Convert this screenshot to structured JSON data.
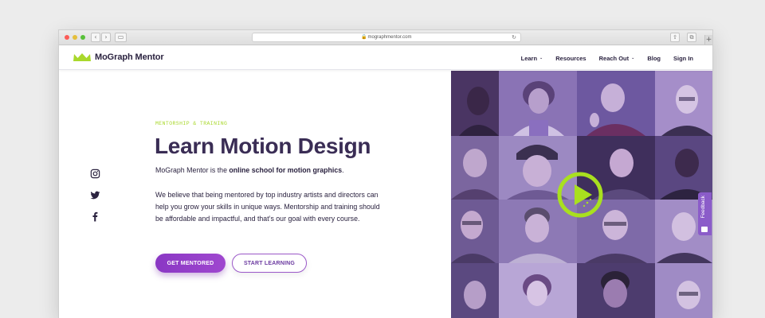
{
  "browser": {
    "url": "mographmentor.com",
    "traffic_lights": [
      "close",
      "minimize",
      "zoom"
    ]
  },
  "header": {
    "logo_text": "MoGraph Mentor",
    "logo_icon": "crown-icon",
    "nav": [
      {
        "label": "Learn",
        "dropdown": true
      },
      {
        "label": "Resources",
        "dropdown": false
      },
      {
        "label": "Reach Out",
        "dropdown": true
      },
      {
        "label": "Blog",
        "dropdown": false
      },
      {
        "label": "Sign In",
        "dropdown": false
      }
    ]
  },
  "hero": {
    "eyebrow": "MENTORSHIP & TRAINING",
    "headline": "Learn Motion Design",
    "intro_prefix": "MoGraph Mentor is the ",
    "intro_bold": "online school for motion graphics",
    "intro_suffix": ".",
    "body": "We believe that being mentored by top industry artists and directors can help you grow your skills in unique ways. Mentorship and training should be affordable and impactful, and that’s our goal with every course.",
    "primary_cta": "GET MENTORED",
    "secondary_cta": "START LEARNING"
  },
  "social": [
    "instagram-icon",
    "twitter-icon",
    "facebook-icon"
  ],
  "media": {
    "tiles_count": 16,
    "play_icon": "play-icon"
  },
  "feedback_tab": "Feedback",
  "colors": {
    "brand_purple": "#8a37c4",
    "accent_lime": "#a9d82c",
    "heading": "#3a2d55",
    "text": "#2b2340"
  }
}
